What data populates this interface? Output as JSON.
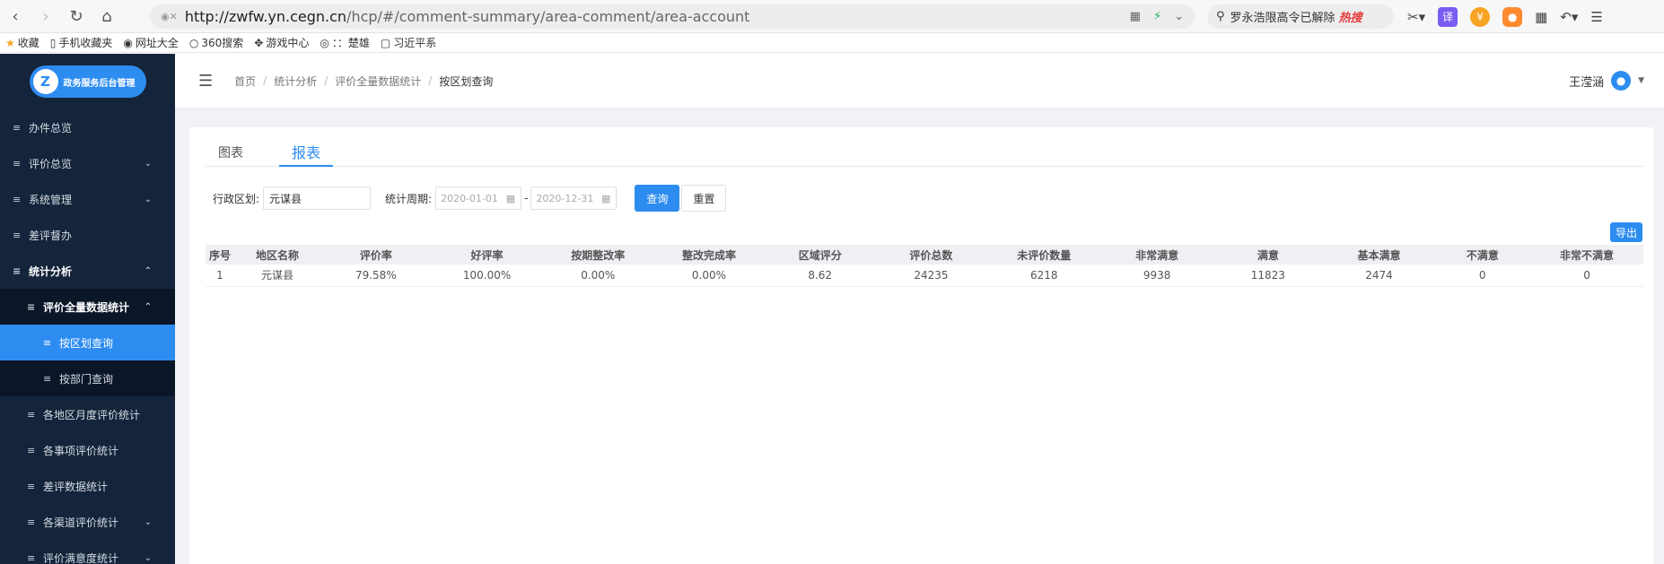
{
  "browser": {
    "url_host": "http://zwfw.yn.cegn.cn",
    "url_path": "/hcp/#/comment-summary/area-comment/area-account",
    "search_text": "罗永浩限高令已解除",
    "search_hot": "热搜"
  },
  "bookmarks": [
    {
      "icon": "★",
      "label": "收藏"
    },
    {
      "icon": "▯",
      "label": "手机收藏夹"
    },
    {
      "icon": "◉",
      "label": "网址大全"
    },
    {
      "icon": "○",
      "label": "360搜索"
    },
    {
      "icon": "✥",
      "label": "游戏中心"
    },
    {
      "icon": "◎",
      "label": "：：楚雄"
    },
    {
      "icon": "▢",
      "label": "习近平系"
    }
  ],
  "logo": {
    "icon": "Z",
    "text": "政务服务后台管理"
  },
  "sidebar": {
    "items": [
      {
        "label": "办件总览",
        "arrow": ""
      },
      {
        "label": "评价总览",
        "arrow": "⌄"
      },
      {
        "label": "系统管理",
        "arrow": "⌄"
      },
      {
        "label": "差评督办",
        "arrow": ""
      },
      {
        "label": "统计分析",
        "arrow": "⌃"
      },
      {
        "label": "评价全量数据统计",
        "arrow": "⌃"
      },
      {
        "label": "按区划查询",
        "arrow": ""
      },
      {
        "label": "按部门查询",
        "arrow": ""
      },
      {
        "label": "各地区月度评价统计",
        "arrow": ""
      },
      {
        "label": "各事项评价统计",
        "arrow": ""
      },
      {
        "label": "差评数据统计",
        "arrow": ""
      },
      {
        "label": "各渠道评价统计",
        "arrow": "⌄"
      },
      {
        "label": "评价满意度统计",
        "arrow": "⌄"
      }
    ]
  },
  "breadcrumb": [
    "首页",
    "统计分析",
    "评价全量数据统计",
    "按区划查询"
  ],
  "user": {
    "name": "王滢涵"
  },
  "tabs": [
    "图表",
    "报表"
  ],
  "filter": {
    "region_label": "行政区划:",
    "region_value": "元谋县",
    "period_label": "统计周期:",
    "date_start": "2020-01-01",
    "date_end": "2020-12-31",
    "query_btn": "查询",
    "reset_btn": "重置",
    "export_btn": "导出"
  },
  "table": {
    "headers": [
      "序号",
      "地区名称",
      "评价率",
      "好评率",
      "按期整改率",
      "整改完成率",
      "区域评分",
      "评价总数",
      "未评价数量",
      "非常满意",
      "满意",
      "基本满意",
      "不满意",
      "非常不满意"
    ],
    "rows": [
      [
        "1",
        "元谋县",
        "79.58%",
        "100.00%",
        "0.00%",
        "0.00%",
        "8.62",
        "24235",
        "6218",
        "9938",
        "11823",
        "2474",
        "0",
        "0"
      ]
    ]
  }
}
